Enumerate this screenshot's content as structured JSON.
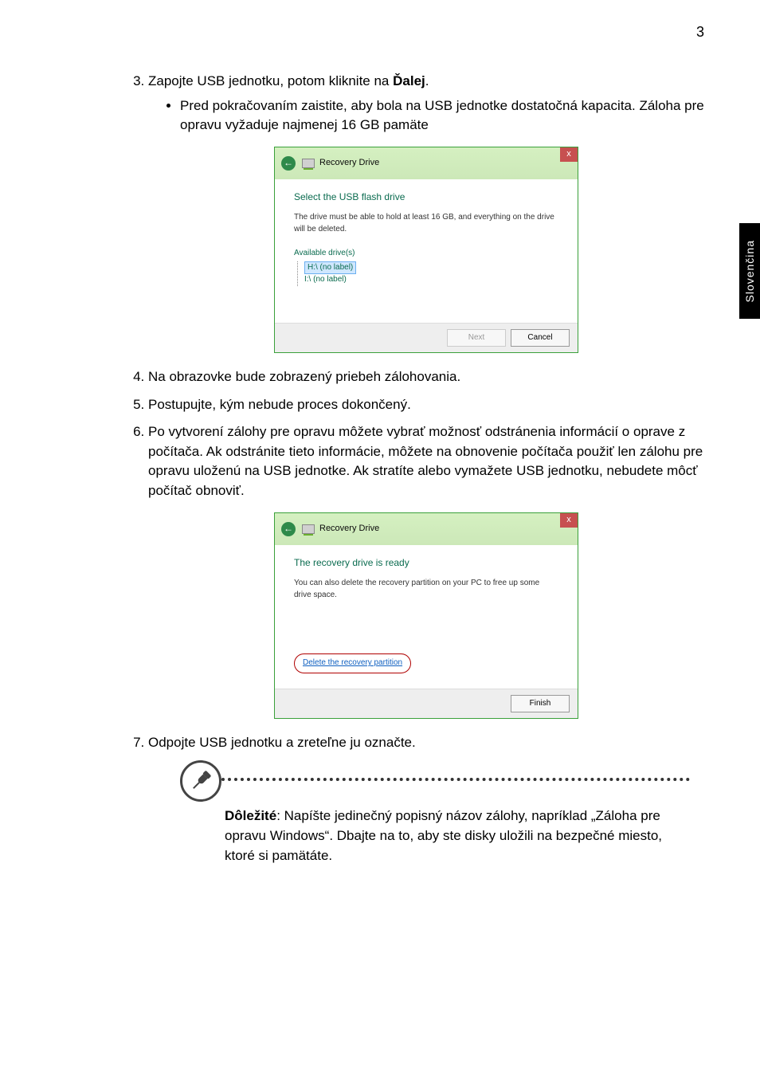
{
  "page_number": "3",
  "side_tab": "Slovenčina",
  "step3": {
    "prefix": "Zapojte USB jednotku, potom kliknite na ",
    "bold": "Ďalej",
    "suffix": ".",
    "bullet": "Pred pokračovaním zaistite, aby bola na USB jednotke dostatočná kapacita. Záloha pre opravu vyžaduje najmenej 16 GB pamäte"
  },
  "dialog1": {
    "title": "Recovery Drive",
    "close": "x",
    "heading": "Select the USB flash drive",
    "text": "The drive must be able to hold at least 16 GB, and everything on the drive will be deleted.",
    "available_label": "Available drive(s)",
    "drive_selected": "H:\\ (no label)",
    "drive_other": "I:\\ (no label)",
    "next_btn": "Next",
    "cancel_btn": "Cancel"
  },
  "step4": "Na obrazovke bude zobrazený priebeh zálohovania.",
  "step5": "Postupujte, kým nebude proces dokončený.",
  "step6": "Po vytvorení zálohy pre opravu môžete vybrať možnosť odstránenia informácií o oprave z počítača. Ak odstránite tieto informácie, môžete na obnovenie počítača použiť len zálohu pre opravu uloženú na USB jednotke. Ak stratíte alebo vymažete USB jednotku, nebudete môcť počítač obnoviť.",
  "dialog2": {
    "title": "Recovery Drive",
    "close": "x",
    "heading": "The recovery drive is ready",
    "text": "You can also delete the recovery partition on your PC to free up some drive space.",
    "link": "Delete the recovery partition",
    "finish_btn": "Finish"
  },
  "step7": "Odpojte USB jednotku a zreteľne ju označte.",
  "note": {
    "bold": "Dôležité",
    "text": ": Napíšte jedinečný popisný názov zálohy, napríklad „Záloha pre opravu Windows“. Dbajte na to, aby ste disky uložili na bezpečné miesto, ktoré si pamätáte."
  }
}
